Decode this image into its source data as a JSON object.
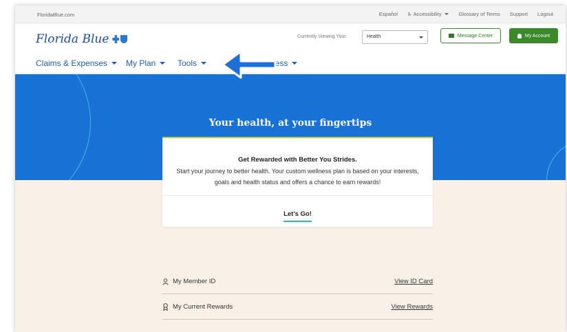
{
  "util": {
    "site": "FloridaBlue.com",
    "links": [
      "Español",
      "Accessibility",
      "Glossary of Terms",
      "Support",
      "Logout"
    ]
  },
  "header": {
    "logo_text": "Florida Blue",
    "viewing_label": "Currently Viewing Your:",
    "viewing_value": "Health",
    "message_center": "Message Center",
    "my_account": "My Account"
  },
  "nav": {
    "items": [
      "Claims & Expenses",
      "My Plan",
      "Tools",
      "Wellness"
    ]
  },
  "hero": {
    "title": "Your health, at your fingertips"
  },
  "card": {
    "title": "Get Rewarded with Better You Strides.",
    "body": "Start your journey to better health. Your custom wellness plan is based on your interests, goals and health status and offers a chance to earn rewards!",
    "cta": "Let's Go!"
  },
  "rows": [
    {
      "label": "My Member ID",
      "link": "View ID Card",
      "icon": "person-icon"
    },
    {
      "label": "My Current Rewards",
      "link": "View Rewards",
      "icon": "award-icon"
    }
  ],
  "colors": {
    "brand_blue": "#1872d6",
    "nav_blue": "#1f5fb0",
    "green": "#3a8a2a",
    "cream": "#f9f1e8",
    "teal": "#2ab5b5"
  }
}
